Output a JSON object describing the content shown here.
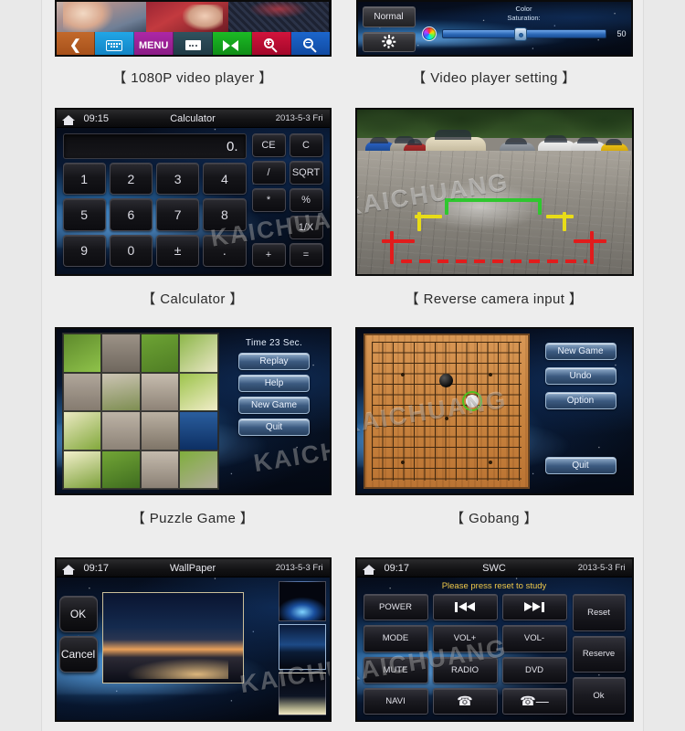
{
  "page": {
    "background": "#e9e9e9",
    "content_background": "#ededed",
    "watermark": "KAICHUANG"
  },
  "cards": [
    {
      "id": "video-player",
      "caption": "【 1080P video player 】",
      "toolbar": [
        {
          "label": "back",
          "icon": "chevron-left-icon",
          "color": "#b45a22"
        },
        {
          "label": "keyboard",
          "icon": "keyboard-icon",
          "color": "#1693d6"
        },
        {
          "label": "MENU",
          "icon": "menu-text",
          "color": "#9c2295"
        },
        {
          "label": "more",
          "icon": "more-dots-icon",
          "color": "#274653"
        },
        {
          "label": "next",
          "icon": "skip-next-icon",
          "color": "#15a01d"
        },
        {
          "label": "zoom-in",
          "icon": "zoom-in-icon",
          "color": "#c10b33"
        },
        {
          "label": "zoom-out",
          "icon": "zoom-out-icon",
          "color": "#1557b5"
        }
      ]
    },
    {
      "id": "video-player-setting",
      "caption": "【 Video player setting 】",
      "tabs": [
        {
          "label": "Normal",
          "icon": "normal-tab"
        },
        {
          "label": "",
          "icon": "brightness-sun-icon"
        }
      ],
      "slider": {
        "label_line1": "Color",
        "label_line2": "Saturation:",
        "value": "50",
        "icon": "color-wheel-icon"
      }
    },
    {
      "id": "calculator",
      "caption": "【 Calculator 】",
      "statusbar": {
        "time": "09:15",
        "title": "Calculator",
        "date": "2013-5-3 Fri",
        "home_icon": "home-icon"
      },
      "display": "0.",
      "keys": [
        "1",
        "2",
        "3",
        "4",
        "5",
        "6",
        "7",
        "8",
        "9",
        "0",
        "±",
        "."
      ],
      "ops": [
        "CE",
        "C",
        "/",
        "SQRT",
        "*",
        "%",
        "",
        "1/X",
        "+",
        "="
      ]
    },
    {
      "id": "reverse-camera",
      "caption": "【 Reverse camera input 】",
      "guide_colors": {
        "near": "#e11c1c",
        "mid": "#e8dc17",
        "far": "#2fc72f"
      }
    },
    {
      "id": "puzzle-game",
      "caption": "【 Puzzle Game 】",
      "time_label": "Time 23 Sec.",
      "buttons": [
        "Replay",
        "Help",
        "New Game",
        "Quit"
      ]
    },
    {
      "id": "gobang",
      "caption": "【 Gobang 】",
      "buttons": [
        "New Game",
        "Undo",
        "Option",
        "Quit"
      ],
      "stones": [
        {
          "color": "black",
          "selected": false
        },
        {
          "color": "white",
          "selected": true
        }
      ]
    },
    {
      "id": "wallpaper",
      "caption": "",
      "statusbar": {
        "time": "09:17",
        "title": "WallPaper",
        "date": "2013-5-3 Fri",
        "home_icon": "home-icon"
      },
      "buttons": [
        "OK",
        "Cancel"
      ],
      "thumbnail_count": 3
    },
    {
      "id": "swc",
      "caption": "",
      "statusbar": {
        "time": "09:17",
        "title": "SWC",
        "date": "2013-5-3 Fri",
        "home_icon": "home-icon"
      },
      "hint": "Please press reset to study",
      "main_buttons": [
        {
          "label": "POWER",
          "icon": ""
        },
        {
          "label": "",
          "icon": "skip-prev-icon"
        },
        {
          "label": "",
          "icon": "skip-next-icon"
        },
        {
          "label": "MODE",
          "icon": ""
        },
        {
          "label": "VOL+",
          "icon": ""
        },
        {
          "label": "VOL-",
          "icon": ""
        },
        {
          "label": "MUTE",
          "icon": ""
        },
        {
          "label": "RADIO",
          "icon": ""
        },
        {
          "label": "DVD",
          "icon": ""
        },
        {
          "label": "NAVI",
          "icon": ""
        },
        {
          "label": "",
          "icon": "phone-icon"
        },
        {
          "label": "",
          "icon": "phone-end-icon"
        }
      ],
      "side_buttons": [
        "Reset",
        "Reserve",
        "Ok"
      ]
    }
  ]
}
